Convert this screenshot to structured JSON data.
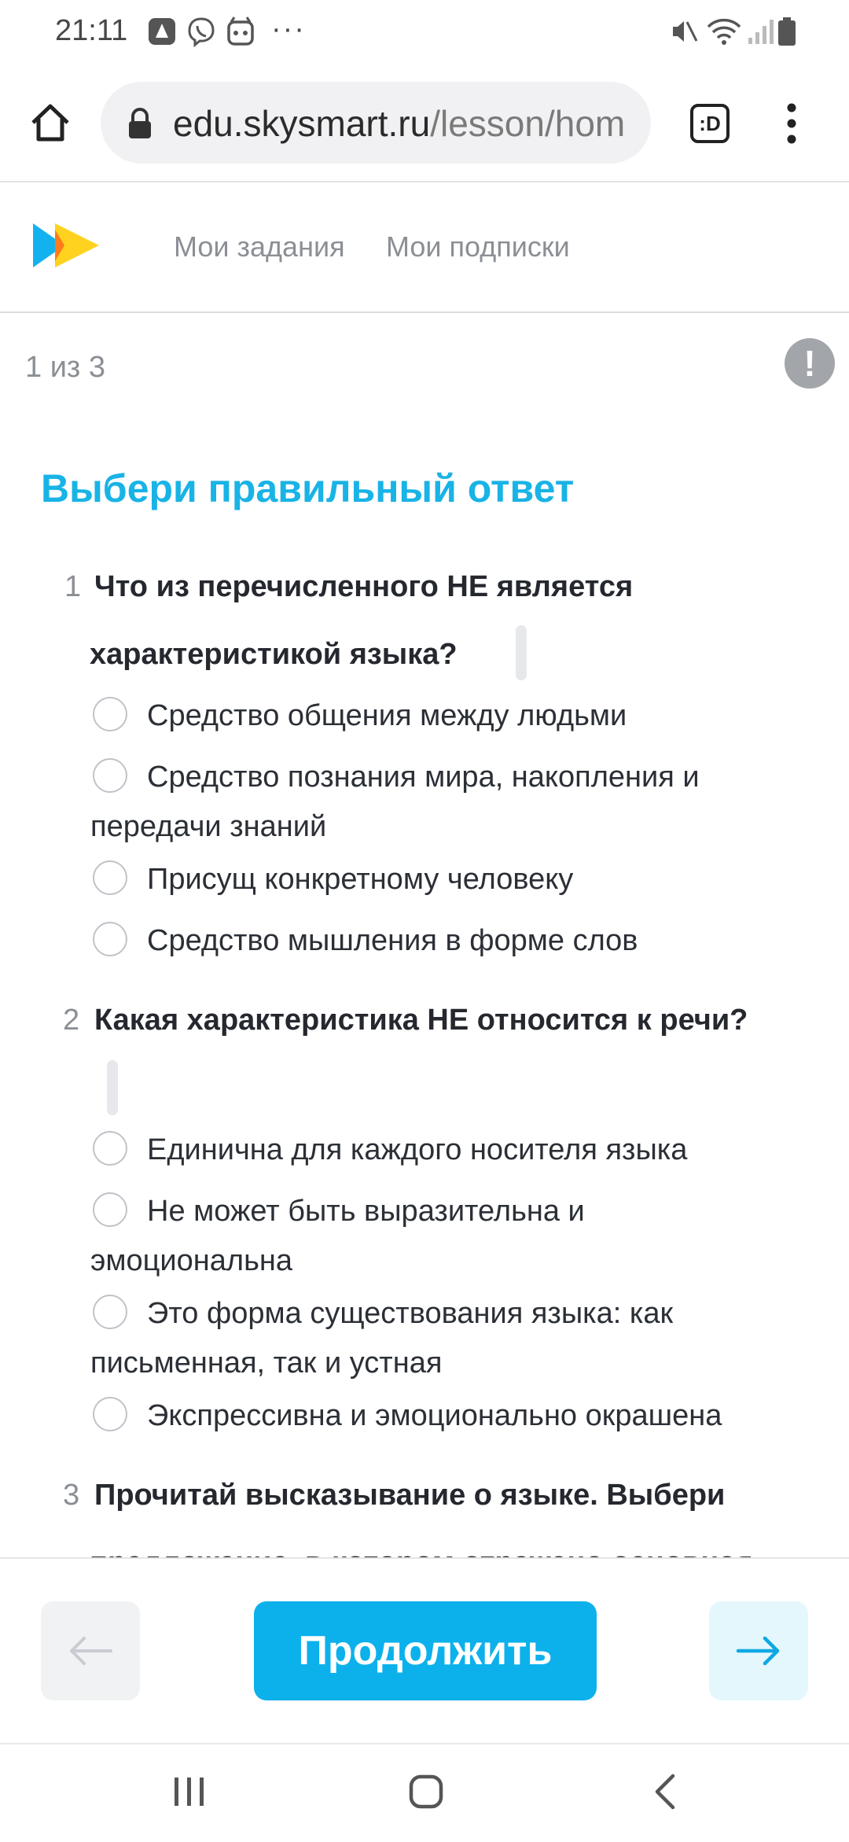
{
  "status_bar": {
    "time": "21:11",
    "overflow": "···"
  },
  "browser": {
    "url_host": "edu.skysmart.ru",
    "url_path": "/lesson/hom",
    "tab_badge": ":D"
  },
  "site_nav": {
    "my_tasks": "Мои задания",
    "my_subscriptions": "Мои подписки"
  },
  "progress": "1 из 3",
  "alert_icon_text": "!",
  "title": "Выбери правильный ответ",
  "questions": [
    {
      "number": "1",
      "text_line1": "Что из перечисленного НЕ является",
      "text_line2": "характеристикой языка?",
      "options": [
        "Средство общения между людьми",
        "Средство познания мира, накопления и",
        "передачи знаний",
        "Присущ конкретному человеку",
        "Средство мышления в форме слов"
      ]
    },
    {
      "number": "2",
      "text": "Какая характеристика НЕ относится к речи?",
      "options": [
        "Единична для каждого носителя языка",
        "Не может быть выразительна и",
        "эмоциональна",
        "Это форма существования языка: как",
        "письменная, так и устная",
        "Экспрессивна и эмоционально окрашена"
      ]
    },
    {
      "number": "3",
      "text_line1": "Прочитай высказывание о языке. Выбери",
      "text_line2": "предложение, в котором отражено основная"
    }
  ],
  "buttons": {
    "continue": "Продолжить"
  },
  "colors": {
    "accent": "#19b3e6",
    "button": "#0cb1ec"
  }
}
